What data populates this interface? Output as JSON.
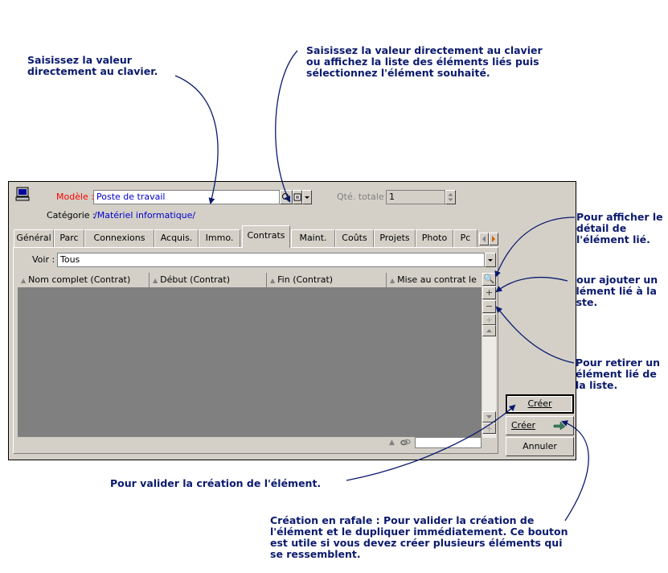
{
  "callouts": {
    "top_left": "Saisissez la valeur\ndirectement au clavier.",
    "top_right": "Saisissez la valeur directement au clavier\nou affichez la liste des éléments liés puis\nsélectionnez l'élément souhaité.",
    "right_detail": "Pour afficher le\ndétail de\nl'élément lié.",
    "right_add": "Pour ajouter un\nélément lié à la\nliste.",
    "right_remove": "Pour retirer un\nélément lié de\nla liste.",
    "bottom_validate": "Pour valider la création de l'élément.",
    "bottom_burst": "Création en rafale : Pour valider la création de\nl'élément et le dupliquer immédiatement. Ce bouton\nest utile si vous devez créer plusieurs éléments qui\nse ressemblent."
  },
  "form": {
    "model_label": "Modèle :",
    "model_value": "Poste de travail",
    "qty_label": "Qté. totale :",
    "qty_value": "1",
    "category_label": "Catégorie :",
    "category_value": "/Matériel informatique/",
    "voir_label": "Voir :",
    "voir_value": "Tous"
  },
  "tabs": [
    {
      "label": "Général"
    },
    {
      "label": "Parc"
    },
    {
      "label": "Connexions"
    },
    {
      "label": "Acquis."
    },
    {
      "label": "Immo."
    },
    {
      "label": "Contrats"
    },
    {
      "label": "Maint."
    },
    {
      "label": "Coûts"
    },
    {
      "label": "Projets"
    },
    {
      "label": "Photo"
    },
    {
      "label": "Pc"
    }
  ],
  "active_tab": "Contrats",
  "columns": [
    "Nom complet (Contrat)",
    "Début (Contrat)",
    "Fin (Contrat)",
    "Mise au contrat le"
  ],
  "buttons": {
    "create": "Créer",
    "create_burst": "Créer",
    "cancel": "Annuler"
  },
  "colors": {
    "callout_text": "#0b1a6e",
    "required_label": "#ff0000",
    "link_value": "#0000cc",
    "grid_body": "#808080",
    "window": "#d4d0c8"
  }
}
